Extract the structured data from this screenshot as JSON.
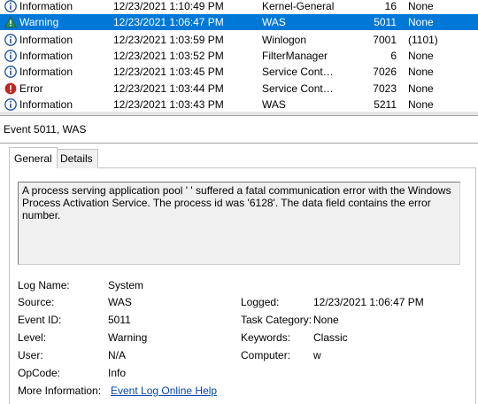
{
  "events": [
    {
      "level": "Information",
      "level_icon": "info-icon",
      "date": "12/23/2021 1:10:49 PM",
      "source": "Kernel-General",
      "id": "16",
      "task": "None",
      "selected": false
    },
    {
      "level": "Warning",
      "level_icon": "warning-icon",
      "date": "12/23/2021 1:06:47 PM",
      "source": "WAS",
      "id": "5011",
      "task": "None",
      "selected": true
    },
    {
      "level": "Information",
      "level_icon": "info-icon",
      "date": "12/23/2021 1:03:59 PM",
      "source": "Winlogon",
      "id": "7001",
      "task": "(1101)",
      "selected": false
    },
    {
      "level": "Information",
      "level_icon": "info-icon",
      "date": "12/23/2021 1:03:52 PM",
      "source": "FilterManager",
      "id": "6",
      "task": "None",
      "selected": false
    },
    {
      "level": "Information",
      "level_icon": "info-icon",
      "date": "12/23/2021 1:03:45 PM",
      "source": "Service Control Manager",
      "id": "7026",
      "task": "None",
      "selected": false
    },
    {
      "level": "Error",
      "level_icon": "error-icon",
      "date": "12/23/2021 1:03:44 PM",
      "source": "Service Control Manager",
      "id": "7023",
      "task": "None",
      "selected": false
    },
    {
      "level": "Information",
      "level_icon": "info-icon",
      "date": "12/23/2021 1:03:43 PM",
      "source": "WAS",
      "id": "5211",
      "task": "None",
      "selected": false
    }
  ],
  "detail": {
    "title": "Event 5011, WAS",
    "tabs": [
      "General",
      "Details"
    ],
    "active_tab": "General",
    "message": "A process serving application pool '                   ' suffered a fatal communication error with the Windows Process Activation Service. The process id was '6128'. The data field contains the error number.",
    "labels": {
      "log_name": "Log Name:",
      "source": "Source:",
      "event_id": "Event ID:",
      "level": "Level:",
      "user": "User:",
      "opcode": "OpCode:",
      "more_info": "More Information:",
      "logged": "Logged:",
      "task_category": "Task Category:",
      "keywords": "Keywords:",
      "computer": "Computer:"
    },
    "values": {
      "log_name": "System",
      "source": "WAS",
      "event_id": "5011",
      "level": "Warning",
      "user": "N/A",
      "opcode": "Info",
      "more_info_link": "Event Log Online Help",
      "logged": "12/23/2021 1:06:47 PM",
      "task_category": "None",
      "keywords": "Classic",
      "computer": "w"
    }
  },
  "colors": {
    "selection": "#0078d7",
    "info_icon": "#1f4e9c",
    "warning_icon": "#2e8b57",
    "error_icon": "#c0271f",
    "link": "#0645ad"
  }
}
